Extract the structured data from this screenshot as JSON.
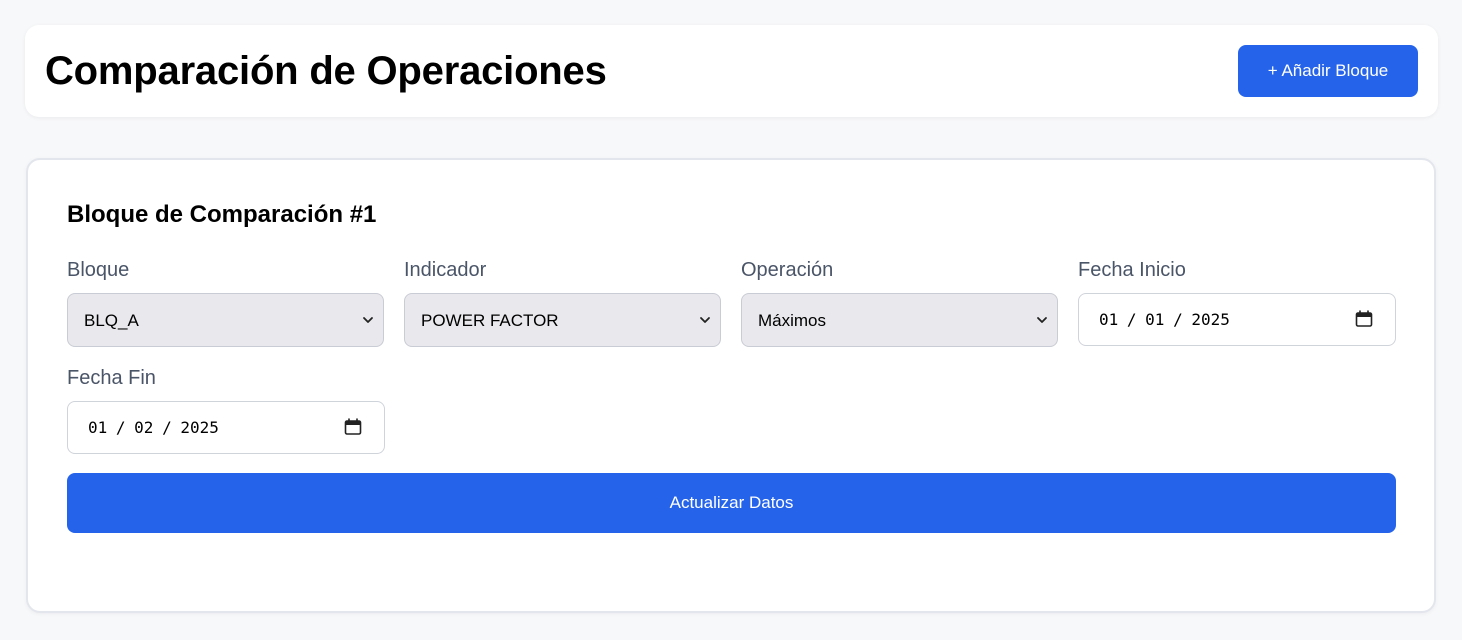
{
  "header": {
    "title": "Comparación de Operaciones",
    "add_button_label": "+ Añadir Bloque"
  },
  "block": {
    "title": "Bloque de Comparación #1",
    "fields": {
      "bloque": {
        "label": "Bloque",
        "value": "BLQ_A"
      },
      "indicador": {
        "label": "Indicador",
        "value": "POWER FACTOR"
      },
      "operacion": {
        "label": "Operación",
        "value": "Máximos"
      },
      "fecha_inicio": {
        "label": "Fecha Inicio",
        "value": "01 / 01 / 2025"
      },
      "fecha_fin": {
        "label": "Fecha Fin",
        "value": "01 / 02 / 2025"
      }
    },
    "update_button_label": "Actualizar Datos"
  },
  "icons": {
    "dropdown": "chevron-down-icon",
    "date_picker": "calendar-icon"
  },
  "colors": {
    "primary": "#2563eb",
    "background": "#f7f8fa",
    "label": "#4a5568",
    "select_bg": "#e8e8ed"
  }
}
